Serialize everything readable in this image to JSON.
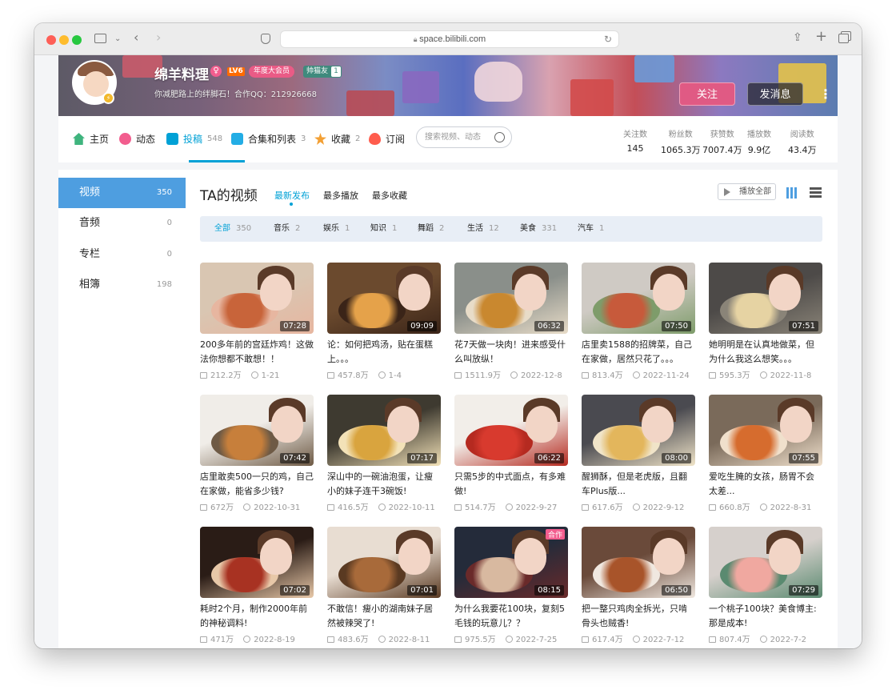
{
  "browser": {
    "url": "space.bilibili.com"
  },
  "profile": {
    "name": "绵羊料理",
    "level": "LV6",
    "tag1": "年度大会员",
    "tag2": "帅猫友",
    "tag2_num": "1",
    "sign": "你减肥路上的绊脚石！合作QQ：212926668",
    "follow_label": "关注",
    "message_label": "发消息"
  },
  "nav": {
    "items": [
      {
        "label": "主页",
        "count": ""
      },
      {
        "label": "动态",
        "count": ""
      },
      {
        "label": "投稿",
        "count": "548"
      },
      {
        "label": "合集和列表",
        "count": "3"
      },
      {
        "label": "收藏",
        "count": "2"
      },
      {
        "label": "订阅",
        "count": ""
      }
    ],
    "search_placeholder": "搜索视频、动态",
    "stats": [
      {
        "label": "关注数",
        "value": "145"
      },
      {
        "label": "粉丝数",
        "value": "1065.3万"
      },
      {
        "label": "获赞数",
        "value": "7007.4万"
      },
      {
        "label": "播放数",
        "value": "9.9亿"
      },
      {
        "label": "阅读数",
        "value": "43.4万"
      }
    ]
  },
  "sidebar": {
    "items": [
      {
        "label": "视频",
        "count": "350"
      },
      {
        "label": "音频",
        "count": "0"
      },
      {
        "label": "专栏",
        "count": "0"
      },
      {
        "label": "相簿",
        "count": "198"
      }
    ]
  },
  "main": {
    "title": "TA的视频",
    "sort_tabs": [
      "最新发布",
      "最多播放",
      "最多收藏"
    ],
    "play_all": "播放全部",
    "filters": [
      {
        "label": "全部",
        "count": "350"
      },
      {
        "label": "音乐",
        "count": "2"
      },
      {
        "label": "娱乐",
        "count": "1"
      },
      {
        "label": "知识",
        "count": "1"
      },
      {
        "label": "舞蹈",
        "count": "2"
      },
      {
        "label": "生活",
        "count": "12"
      },
      {
        "label": "美食",
        "count": "331"
      },
      {
        "label": "汽车",
        "count": "1"
      }
    ],
    "videos": [
      {
        "title": "200多年前的宫廷炸鸡！这做法你想都不敢想！！",
        "duration": "07:28",
        "plays": "212.2万",
        "date": "1-21"
      },
      {
        "title": "论：如何把鸡汤，贴在蛋糕上。。。",
        "duration": "09:09",
        "plays": "457.8万",
        "date": "1-4"
      },
      {
        "title": "花7天做一块肉！进来感受什么叫放纵！",
        "duration": "06:32",
        "plays": "1511.9万",
        "date": "2022-12-8"
      },
      {
        "title": "店里卖1588的招牌菜，自己在家做，居然只花了。。。",
        "duration": "07:50",
        "plays": "813.4万",
        "date": "2022-11-24"
      },
      {
        "title": "她明明是在认真地做菜，但为什么我这么想笑。。。",
        "duration": "07:51",
        "plays": "595.3万",
        "date": "2022-11-8"
      },
      {
        "title": "店里敢卖500一只的鸡，自己在家做，能省多少钱?",
        "duration": "07:42",
        "plays": "672万",
        "date": "2022-10-31"
      },
      {
        "title": "深山中的一碗油泡蛋，让瘦小的妹子连干3碗饭!",
        "duration": "07:17",
        "plays": "416.5万",
        "date": "2022-10-11"
      },
      {
        "title": "只需5步的中式面点，有多难做!",
        "duration": "06:22",
        "plays": "514.7万",
        "date": "2022-9-27"
      },
      {
        "title": "醒狮酥，但是老虎版，且翻车Plus版...",
        "duration": "08:00",
        "plays": "617.6万",
        "date": "2022-9-12"
      },
      {
        "title": "爱吃生腌的女孩，肠胃不会太差...",
        "duration": "07:55",
        "plays": "660.8万",
        "date": "2022-8-31"
      },
      {
        "title": "耗时2个月，制作2000年前的神秘调料!",
        "duration": "07:02",
        "plays": "471万",
        "date": "2022-8-19"
      },
      {
        "title": "不敢信！瘦小的湖南妹子居然被辣哭了!",
        "duration": "07:01",
        "plays": "483.6万",
        "date": "2022-8-11"
      },
      {
        "title": "为什么我要花100块，复刻5毛钱的玩意儿？？",
        "duration": "08:15",
        "plays": "975.5万",
        "date": "2022-7-25",
        "badge": "合作"
      },
      {
        "title": "把一整只鸡肉全拆光，只啃骨头也贼香!",
        "duration": "06:50",
        "plays": "617.4万",
        "date": "2022-7-12"
      },
      {
        "title": "一个桃子100块？美食博主:那是成本!",
        "duration": "07:29",
        "plays": "807.4万",
        "date": "2022-7-2"
      }
    ]
  },
  "colors": {
    "accent": "#00a1d6",
    "sidebar_active": "#4e9ee0",
    "follow": "#e05a84"
  }
}
